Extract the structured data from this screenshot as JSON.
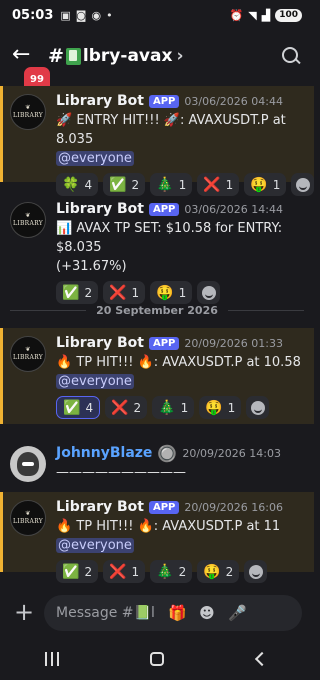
{
  "status": {
    "time": "05:03",
    "icons": [
      "sim-icon",
      "screenshot-icon",
      "vpn-icon"
    ],
    "right_icons": [
      "alarm-icon",
      "wifi-icon",
      "signal-icon"
    ],
    "battery": "100"
  },
  "header": {
    "back_glyph": "←",
    "unread_badge": "99",
    "hash": "#",
    "channel_name": "lbry-avax",
    "chevron": "›"
  },
  "messages": [
    {
      "author": "Library Bot",
      "app_tag": "APP",
      "timestamp": "03/06/2026 04:44",
      "lines": [
        "🚀 ENTRY HIT!!! 🚀: AVAXUSDT.P at 8.035"
      ],
      "mention": "@everyone",
      "reactions": [
        {
          "emoji": "🍀",
          "count": "4"
        },
        {
          "emoji": "✅",
          "count": "2"
        },
        {
          "emoji": "🎄",
          "count": "1"
        },
        {
          "emoji": "❌",
          "count": "1"
        },
        {
          "emoji": "🤑",
          "count": "1"
        }
      ]
    },
    {
      "author": "Library Bot",
      "app_tag": "APP",
      "timestamp": "03/06/2026 14:44",
      "lines": [
        "📊 AVAX TP SET: $10.58 for ENTRY: $8.035",
        "(+31.67%)"
      ],
      "reactions": [
        {
          "emoji": "✅",
          "count": "2"
        },
        {
          "emoji": "❌",
          "count": "1"
        },
        {
          "emoji": "🤑",
          "count": "1"
        }
      ]
    },
    {
      "author": "Library Bot",
      "app_tag": "APP",
      "timestamp": "20/09/2026 01:33",
      "lines": [
        "🔥 TP HIT!!! 🔥: AVAXUSDT.P at 10.58"
      ],
      "mention": "@everyone",
      "reactions": [
        {
          "emoji": "✅",
          "count": "4",
          "me": true
        },
        {
          "emoji": "❌",
          "count": "2"
        },
        {
          "emoji": "🎄",
          "count": "1"
        },
        {
          "emoji": "🤑",
          "count": "1"
        }
      ]
    },
    {
      "author": "JohnnyBlaze",
      "badge": "🔘",
      "timestamp": "20/09/2026 14:03",
      "lines": [
        "——————————"
      ]
    },
    {
      "author": "Library Bot",
      "app_tag": "APP",
      "timestamp": "20/09/2026 16:06",
      "lines": [
        "🔥 TP HIT!!! 🔥: AVAXUSDT.P at 11"
      ],
      "mention": "@everyone",
      "reactions": [
        {
          "emoji": "✅",
          "count": "2"
        },
        {
          "emoji": "❌",
          "count": "1"
        },
        {
          "emoji": "🎄",
          "count": "2"
        },
        {
          "emoji": "🤑",
          "count": "2"
        }
      ]
    }
  ],
  "date_divider": "20 September 2026",
  "composer": {
    "placeholder": "Message #📗lbry..."
  }
}
